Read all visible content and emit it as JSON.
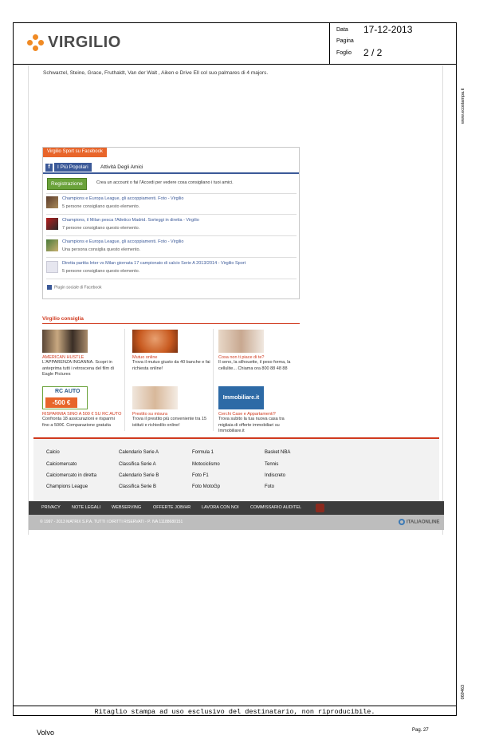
{
  "header": {
    "logo_text": "VIRGILIO",
    "data_label": "Data",
    "pagina_label": "Pagina",
    "foglio_label": "Foglio",
    "data_value": "17-12-2013",
    "foglio_value": "2 / 2"
  },
  "side": {
    "url": "www.ecostampa.it",
    "code": "069463"
  },
  "article": {
    "snippet": "Schwarzel, Steine, Grace, Fruthaldt, Van der Walt , Aiken e Drive Ell col suo palmares di 4 majors."
  },
  "facebook": {
    "header": "Virgilio Sport su Facebook",
    "tab_icon": "f",
    "tab_popular": "I Più Popolari",
    "tab_friends": "Attività Degli Amici",
    "register_button": "Registrazione",
    "register_text": "Crea un account o fai l'Accedi per vedere cosa consigliano i tuoi amici.",
    "items": [
      {
        "title": "Champions e Europa League, gli accoppiamenti. Foto - Virgilio",
        "sub": "5 persone consigliano questo elemento."
      },
      {
        "title": "Champions, il Milan pesca l'Atletico Madrid. Sorteggi in diretta - Virgilio",
        "sub": "7 persone consigliano questo elemento."
      },
      {
        "title": "Champions e Europa League, gli accoppiamenti. Foto - Virgilio",
        "sub": "Una persona consiglia questo elemento."
      },
      {
        "title": "Diretta partita Inter vs Milan giornata 17 campionato di calcio Serie A 2013/2014 - Virgilio Sport",
        "sub": "5 persone consigliano questo elemento."
      }
    ],
    "plugin": "Plugin sociale di Facebook",
    "colors": {
      "header": "#e8652a",
      "brand": "#3b5998",
      "register": "#6aa23a"
    }
  },
  "consiglia": {
    "title": "Virgilio consiglia",
    "cards": [
      {
        "title": "AMERICAN HUSTLE",
        "text": "L'APPARENZA INGANNA. Scopri in anteprima tutti i retroscena del film di Eagle Pictures",
        "icon": "movie-poster-image"
      },
      {
        "title": "Mutuo online",
        "text": "Trova il mutuo giusto da 40 banche e fai richiesta online!",
        "icon": "mutuo-image"
      },
      {
        "title": "Cosa non ti piace di te?",
        "text": "Il seno, la silhouette, il peso forma, la cellulite... Chiama ora 800 88 48 88",
        "icon": "woman-image"
      },
      {
        "title": "RISPARMIA SINO A 500 € SU RC AUTO",
        "text": "Confronta 18 assicurazioni e risparmi fino a 500€. Comparazione gratuita",
        "icon": "rc-auto-banner",
        "banner_top": "RC AUTO",
        "banner_bottom": "-500 €"
      },
      {
        "title": "Prestito su misura",
        "text": "Trova il prestito più conveniente tra 15 istituti e richiedilo online!",
        "icon": "call-center-image"
      },
      {
        "title": "Cerchi Case e Appartamenti?",
        "text": "Trova subito la tua nuova casa tra migliaia di offerte immobiliari su Immobiliare.it",
        "icon": "immobiliare-logo",
        "banner": "Immobiliare.it"
      }
    ]
  },
  "footer_links": [
    [
      "Calcio",
      "Calendario Serie A",
      "Formula 1",
      "Basket NBA"
    ],
    [
      "Calciomercato",
      "Classifica Serie A",
      "Motociclismo",
      "Tennis"
    ],
    [
      "Calciomercato in diretta",
      "Calendario Serie B",
      "Foto F1",
      "Indiscreto"
    ],
    [
      "Champions League",
      "Classifica Serie B",
      "Foto MotoGp",
      "Foto"
    ]
  ],
  "bar": [
    "PRIVACY",
    "NOTE LEGALI",
    "WEBSERVING",
    "OFFERTE JOB/HR",
    "LAVORA CON NOI",
    "COMMISSARIO AUDITEL"
  ],
  "copyright": "© 1997 - 2013 MATRIX S.P.A. TUTTI I DIRITTI RISERVATI - P. IVA 11188680151",
  "italia_online": "ITALIAONLINE",
  "disclaimer": "Ritaglio stampa ad uso esclusivo del destinatario, non riproducibile.",
  "brand_footer": "Volvo",
  "page_num": "Pag. 27"
}
